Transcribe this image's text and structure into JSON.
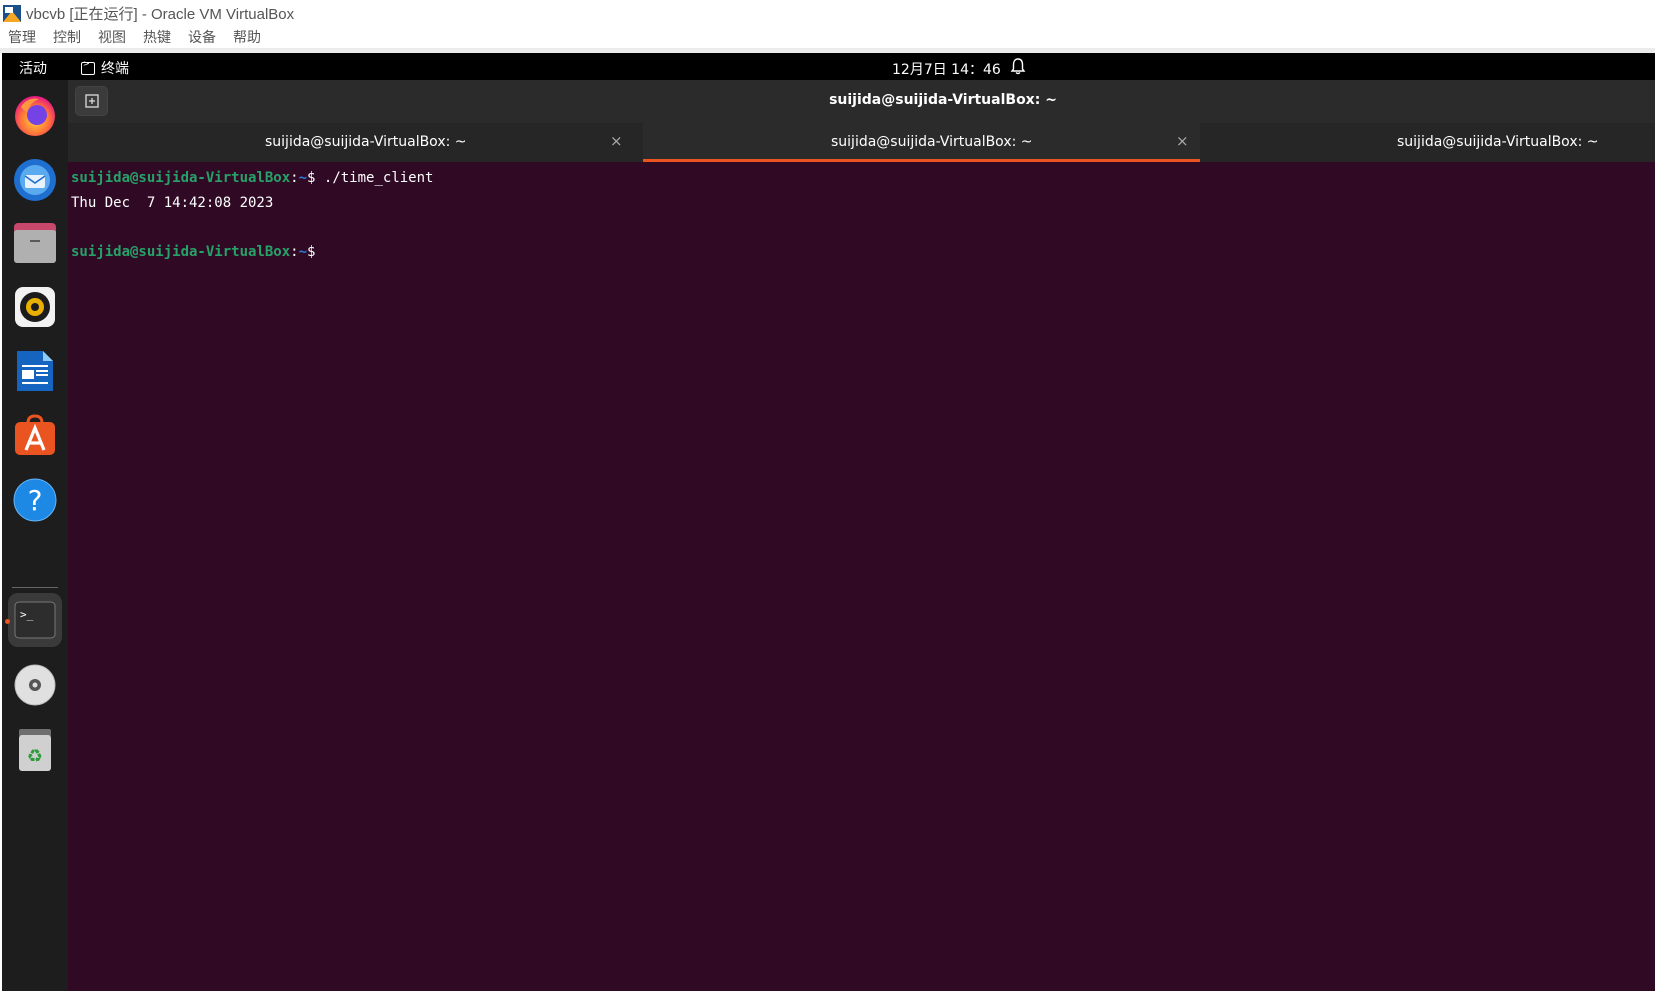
{
  "host": {
    "title": "vbcvb [正在运行] - Oracle VM VirtualBox",
    "menu": [
      "管理",
      "控制",
      "视图",
      "热键",
      "设备",
      "帮助"
    ]
  },
  "topbar": {
    "activities": "活动",
    "app_name": "终端",
    "clock": "12月7日  14：46"
  },
  "dock": {
    "items": [
      "firefox-icon",
      "thunderbird-icon",
      "files-icon",
      "rhythmbox-icon",
      "libreoffice-writer-icon",
      "app-center-icon",
      "help-icon",
      "terminal-icon",
      "dvd-icon",
      "trash-icon"
    ]
  },
  "terminal": {
    "window_title": "suijida@suijida-VirtualBox: ~",
    "tabs": [
      {
        "label": "suijida@suijida-VirtualBox: ~",
        "close": "×"
      },
      {
        "label": "suijida@suijida-VirtualBox: ~",
        "close": "×"
      },
      {
        "label": "suijida@suijida-VirtualBox: ~"
      }
    ],
    "lines": [
      {
        "user": "suijida@suijida-VirtualBox",
        "sep": ":",
        "path": "~",
        "sym": "$ ",
        "cmd": "./time_client"
      },
      {
        "output": "Thu Dec  7 14:42:08 2023"
      },
      {
        "output": ""
      },
      {
        "user": "suijida@suijida-VirtualBox",
        "sep": ":",
        "path": "~",
        "sym": "$ ",
        "cmd": ""
      }
    ]
  },
  "colors": {
    "terminal_bg": "#300a24",
    "prompt_user": "#26a269",
    "prompt_path": "#2a7bde",
    "accent": "#e95420"
  }
}
